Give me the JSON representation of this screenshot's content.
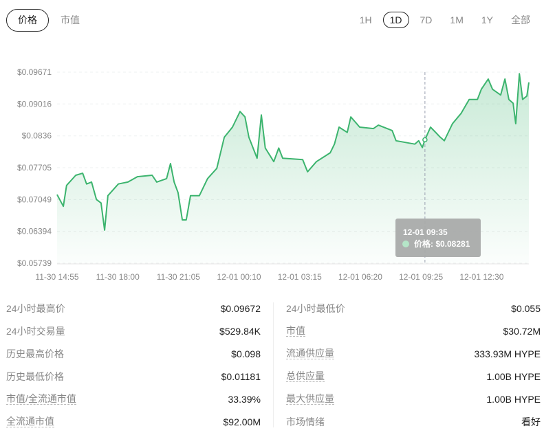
{
  "tabs": [
    "价格",
    "市值"
  ],
  "ranges": [
    "1H",
    "1D",
    "7D",
    "1M",
    "1Y",
    "全部"
  ],
  "active_range": "1D",
  "colors": {
    "line": "#3cb46e",
    "fill": "#3cb46e",
    "tooltip_bg": "#a9abaa",
    "dot": "#b5e6c8"
  },
  "tooltip": {
    "time": "12-01 09:35",
    "label": "价格: $0.08281"
  },
  "chart_data": {
    "type": "area",
    "title": "",
    "xlabel": "",
    "ylabel": "",
    "x_unit": "minutes since 11-30 14:55",
    "x_ticks": [
      {
        "label": "11-30 14:55",
        "x": 0
      },
      {
        "label": "11-30 18:00",
        "x": 185
      },
      {
        "label": "11-30 21:05",
        "x": 370
      },
      {
        "label": "12-01 00:10",
        "x": 555
      },
      {
        "label": "12-01 03:15",
        "x": 740
      },
      {
        "label": "12-01 06:20",
        "x": 925
      },
      {
        "label": "12-01 09:25",
        "x": 1110
      },
      {
        "label": "12-01 12:30",
        "x": 1295
      }
    ],
    "y_ticks": [
      "$0.09671",
      "$0.09016",
      "$0.0836",
      "$0.07705",
      "$0.07049",
      "$0.06394",
      "$0.05739"
    ],
    "y_tick_values": [
      0.09671,
      0.09016,
      0.0836,
      0.07705,
      0.07049,
      0.06394,
      0.05739
    ],
    "xlim": [
      0,
      1439
    ],
    "ylim": [
      0.05739,
      0.09671
    ],
    "grid": true,
    "hover_x": 1122,
    "points": [
      [
        0,
        0.0715
      ],
      [
        19,
        0.0691
      ],
      [
        29,
        0.0734
      ],
      [
        57,
        0.0755
      ],
      [
        78,
        0.0759
      ],
      [
        90,
        0.0737
      ],
      [
        105,
        0.0741
      ],
      [
        120,
        0.0705
      ],
      [
        134,
        0.0698
      ],
      [
        145,
        0.0642
      ],
      [
        155,
        0.0713
      ],
      [
        187,
        0.0737
      ],
      [
        216,
        0.0741
      ],
      [
        245,
        0.0752
      ],
      [
        290,
        0.0755
      ],
      [
        304,
        0.0741
      ],
      [
        334,
        0.0748
      ],
      [
        346,
        0.0779
      ],
      [
        357,
        0.0741
      ],
      [
        369,
        0.0719
      ],
      [
        382,
        0.0663
      ],
      [
        394,
        0.0663
      ],
      [
        407,
        0.0713
      ],
      [
        434,
        0.0713
      ],
      [
        459,
        0.0748
      ],
      [
        487,
        0.0769
      ],
      [
        510,
        0.0833
      ],
      [
        535,
        0.0854
      ],
      [
        558,
        0.0886
      ],
      [
        573,
        0.0875
      ],
      [
        585,
        0.0833
      ],
      [
        610,
        0.079
      ],
      [
        623,
        0.0879
      ],
      [
        635,
        0.0811
      ],
      [
        661,
        0.0783
      ],
      [
        676,
        0.0811
      ],
      [
        688,
        0.079
      ],
      [
        749,
        0.0787
      ],
      [
        764,
        0.0762
      ],
      [
        791,
        0.0783
      ],
      [
        833,
        0.0801
      ],
      [
        846,
        0.0819
      ],
      [
        860,
        0.0854
      ],
      [
        885,
        0.0843
      ],
      [
        896,
        0.0875
      ],
      [
        923,
        0.0854
      ],
      [
        965,
        0.0851
      ],
      [
        980,
        0.0858
      ],
      [
        1022,
        0.0847
      ],
      [
        1034,
        0.0826
      ],
      [
        1091,
        0.0819
      ],
      [
        1103,
        0.0826
      ],
      [
        1114,
        0.0812
      ],
      [
        1122,
        0.0828
      ],
      [
        1139,
        0.0854
      ],
      [
        1169,
        0.0833
      ],
      [
        1181,
        0.0826
      ],
      [
        1206,
        0.0861
      ],
      [
        1232,
        0.0882
      ],
      [
        1257,
        0.0911
      ],
      [
        1282,
        0.0911
      ],
      [
        1294,
        0.0932
      ],
      [
        1315,
        0.0953
      ],
      [
        1328,
        0.0932
      ],
      [
        1353,
        0.092
      ],
      [
        1366,
        0.0953
      ],
      [
        1378,
        0.0911
      ],
      [
        1391,
        0.0903
      ],
      [
        1399,
        0.0861
      ],
      [
        1410,
        0.0964
      ],
      [
        1420,
        0.0911
      ],
      [
        1433,
        0.0918
      ],
      [
        1439,
        0.0946
      ]
    ]
  },
  "stats": {
    "left": [
      {
        "label": "24小时最高价",
        "value": "$0.09672"
      },
      {
        "label": "24小时交易量",
        "value": "$529.84K"
      },
      {
        "label": "历史最高价格",
        "value": "$0.098"
      },
      {
        "label": "历史最低价格",
        "value": "$0.01181"
      },
      {
        "label": "市值/全流通市值",
        "value": "33.39%"
      },
      {
        "label": "全流通市值",
        "value": "$92.00M"
      }
    ],
    "right": [
      {
        "label": "24小时最低价",
        "value": "$0.055"
      },
      {
        "label": "市值",
        "value": "$30.72M"
      },
      {
        "label": "流通供应量",
        "value": "333.93M HYPE"
      },
      {
        "label": "总供应量",
        "value": "1.00B HYPE"
      },
      {
        "label": "最大供应量",
        "value": "1.00B HYPE"
      },
      {
        "label": "市场情绪",
        "value": "看好"
      }
    ]
  }
}
